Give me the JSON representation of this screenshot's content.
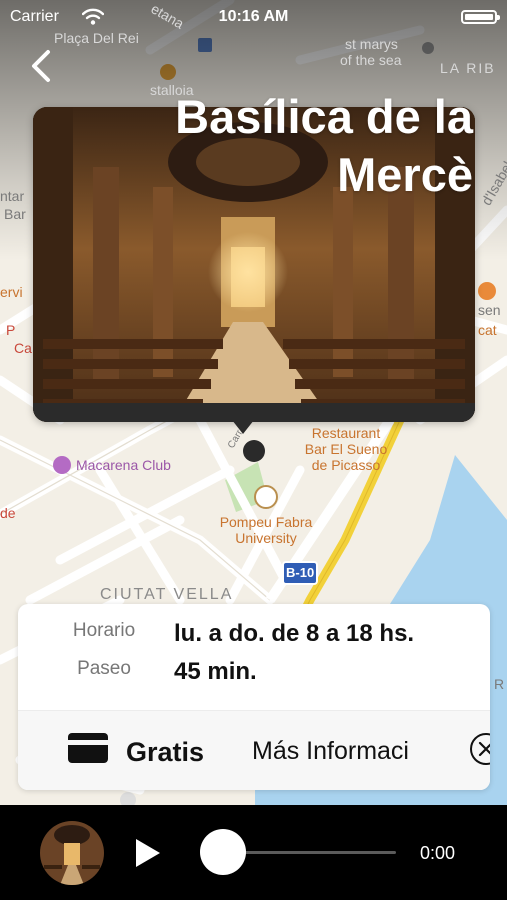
{
  "status_bar": {
    "carrier": "Carrier",
    "time": "10:16 AM"
  },
  "place": {
    "title": "Basílica de la Mercè"
  },
  "map_labels": {
    "placa_del_rei": "Plaça Del Rei",
    "st_marys": "st marys",
    "of_the_sea": "of the sea",
    "la_ribera": "LA RIB",
    "restaurant": "Restaurant",
    "bar_el_sueno": "Bar El Sueno",
    "de_picasso": "de Picasso",
    "macarena": "Macarena Club",
    "pompeu_1": "Pompeu Fabra",
    "pompeu_2": "University",
    "road_b10": "B-10",
    "ciutat_vella": "CIUTAT VELLA",
    "edge_ntar": "ntar",
    "edge_bar": "Bar",
    "edge_ervi": "ervi",
    "edge_p": "P",
    "edge_ca": "Ca",
    "edge_de": "de",
    "edge_sen": "sen",
    "edge_cat": "cat",
    "edge_r": "R",
    "edge_isabel": "d'Isabel",
    "edge_etana": "etana",
    "edge_stalloia": "stalloia",
    "edge_carrer": "Carr"
  },
  "info": {
    "schedule_label": "Horario",
    "schedule_value": "lu. a do. de 8 a 18 hs.",
    "duration_label": "Paseo",
    "duration_value": "45 min.",
    "price_label": "Gratis",
    "more_info_label": "Más Informaci"
  },
  "player": {
    "time": "0:00",
    "progress": 0
  },
  "colors": {
    "accent": "#000000",
    "road_yellow": "#f2d13a",
    "water": "#a5d0ee",
    "park": "#c9e4b8"
  }
}
